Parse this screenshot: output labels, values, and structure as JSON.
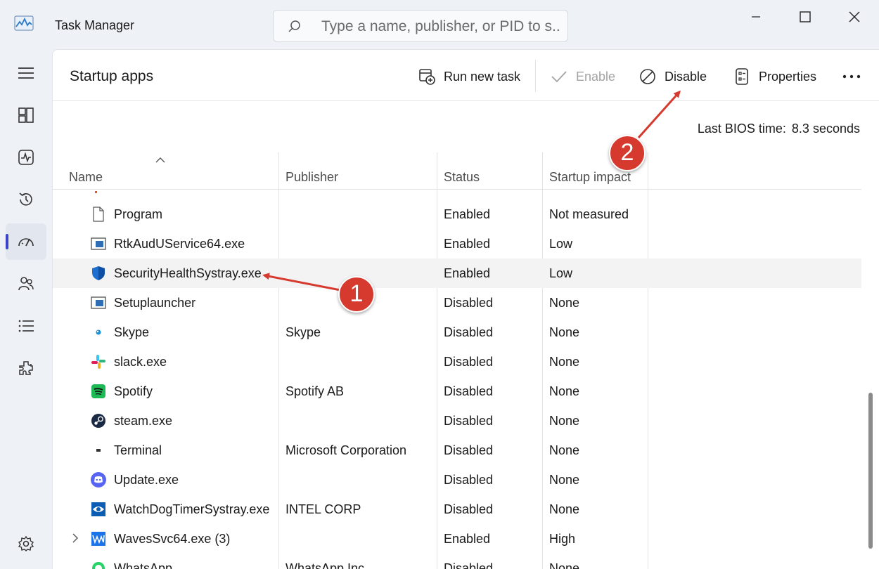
{
  "window": {
    "title": "Task Manager",
    "search_placeholder": "Type a name, publisher, or PID to s..."
  },
  "nav": {
    "items": [
      {
        "name": "hamburger-menu-icon"
      },
      {
        "name": "processes-icon"
      },
      {
        "name": "performance-icon"
      },
      {
        "name": "app-history-icon"
      },
      {
        "name": "startup-apps-icon",
        "active": true
      },
      {
        "name": "users-icon"
      },
      {
        "name": "details-icon"
      },
      {
        "name": "services-icon"
      },
      {
        "name": "settings-icon"
      }
    ]
  },
  "page": {
    "title": "Startup apps",
    "bios_label": "Last BIOS time:",
    "bios_value": "8.3 seconds"
  },
  "toolbar": {
    "run_new_task": "Run new task",
    "enable": "Enable",
    "disable": "Disable",
    "properties": "Properties",
    "more": "..."
  },
  "table": {
    "columns": [
      "Name",
      "Publisher",
      "Status",
      "Startup impact"
    ],
    "rows": [
      {
        "name": "Program",
        "publisher": "",
        "status": "Enabled",
        "impact": "Not measured",
        "icon": "document-icon"
      },
      {
        "name": "RtkAudUService64.exe",
        "publisher": "",
        "status": "Enabled",
        "impact": "Low",
        "icon": "app-window-icon"
      },
      {
        "name": "SecurityHealthSystray.exe",
        "publisher": "",
        "status": "Enabled",
        "impact": "Low",
        "icon": "shield-icon",
        "selected": true
      },
      {
        "name": "Setuplauncher",
        "publisher": "",
        "status": "Disabled",
        "impact": "None",
        "icon": "app-window-icon"
      },
      {
        "name": "Skype",
        "publisher": "Skype",
        "status": "Disabled",
        "impact": "None",
        "icon": "skype-icon"
      },
      {
        "name": "slack.exe",
        "publisher": "",
        "status": "Disabled",
        "impact": "None",
        "icon": "slack-icon"
      },
      {
        "name": "Spotify",
        "publisher": "Spotify AB",
        "status": "Disabled",
        "impact": "None",
        "icon": "spotify-icon"
      },
      {
        "name": "steam.exe",
        "publisher": "",
        "status": "Disabled",
        "impact": "None",
        "icon": "steam-icon"
      },
      {
        "name": "Terminal",
        "publisher": "Microsoft Corporation",
        "status": "Disabled",
        "impact": "None",
        "icon": "terminal-icon"
      },
      {
        "name": "Update.exe",
        "publisher": "",
        "status": "Disabled",
        "impact": "None",
        "icon": "discord-icon"
      },
      {
        "name": "WatchDogTimerSystray.exe",
        "publisher": "INTEL CORP",
        "status": "Disabled",
        "impact": "None",
        "icon": "eye-icon"
      },
      {
        "name": "WavesSvc64.exe (3)",
        "publisher": "",
        "status": "Enabled",
        "impact": "High",
        "icon": "waves-icon",
        "expandable": true
      },
      {
        "name": "WhatsApp",
        "publisher": "WhatsApp Inc.",
        "status": "Disabled",
        "impact": "None",
        "icon": "whatsapp-icon"
      }
    ]
  },
  "annotations": {
    "badge1": "1",
    "badge2": "2",
    "color": "#d63a2f"
  }
}
